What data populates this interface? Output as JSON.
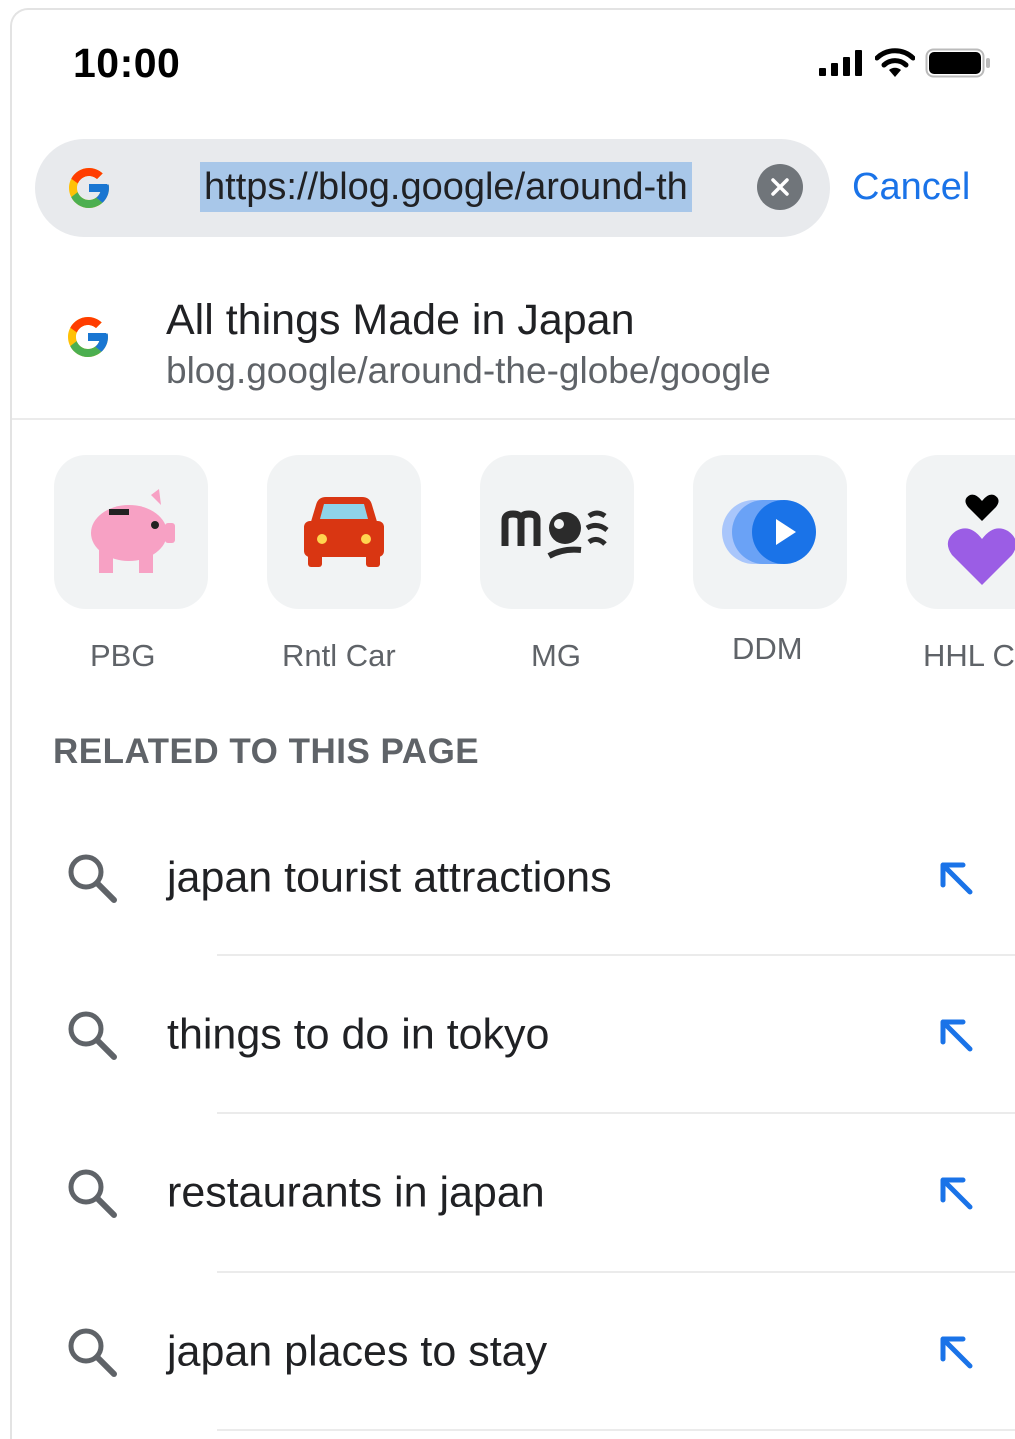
{
  "status_bar": {
    "time": "10:00"
  },
  "omnibox": {
    "url": "https://blog.google/around-th",
    "cancel_label": "Cancel"
  },
  "suggestion": {
    "title": "All things Made in Japan",
    "url": "blog.google/around-the-globe/google"
  },
  "shortcuts": [
    {
      "label": "PBG",
      "icon": "piggy-bank-icon"
    },
    {
      "label": "Rntl Car",
      "icon": "car-icon"
    },
    {
      "label": "MG",
      "icon": "mg-logo-icon"
    },
    {
      "label": "DDM",
      "icon": "play-icon"
    },
    {
      "label": "HHL C",
      "icon": "hearts-icon"
    }
  ],
  "related": {
    "heading": "RELATED TO THIS PAGE",
    "items": [
      {
        "text": "japan tourist attractions"
      },
      {
        "text": "things to do in tokyo"
      },
      {
        "text": "restaurants in japan"
      },
      {
        "text": "japan places to stay"
      }
    ]
  },
  "colors": {
    "accent": "#1a73e8",
    "omnibox_bg": "#e8eaed",
    "selection": "#a8c7e9"
  }
}
